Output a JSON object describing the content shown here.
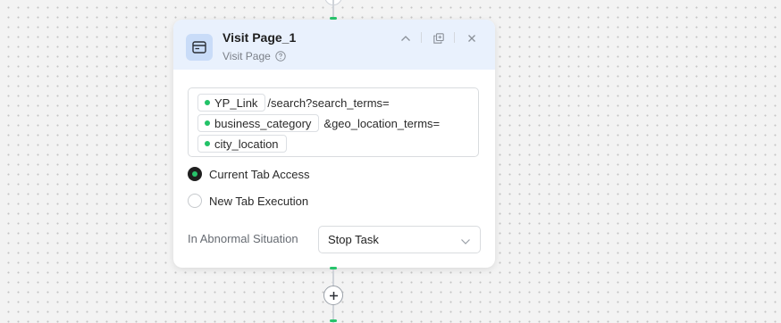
{
  "node": {
    "title": "Visit Page_1",
    "subtitle": "Visit Page",
    "icon": "browser-window-icon",
    "header_actions": [
      "collapse-icon",
      "duplicate-icon",
      "close-icon"
    ]
  },
  "url_builder": {
    "row1": {
      "chip": "YP_Link",
      "text": "/search?search_terms="
    },
    "row2": {
      "chip": "business_category",
      "text": "&geo_location_terms="
    },
    "row3": {
      "chip": "city_location"
    }
  },
  "tab_options": [
    {
      "label": "Current Tab Access",
      "selected": true
    },
    {
      "label": "New Tab Execution",
      "selected": false
    }
  ],
  "abnormal": {
    "label": "In Abnormal Situation",
    "value": "Stop Task"
  },
  "colors": {
    "accent_green": "#27c46b",
    "header_bg": "#e9f1fd",
    "icon_bg": "#c9dcf8"
  }
}
